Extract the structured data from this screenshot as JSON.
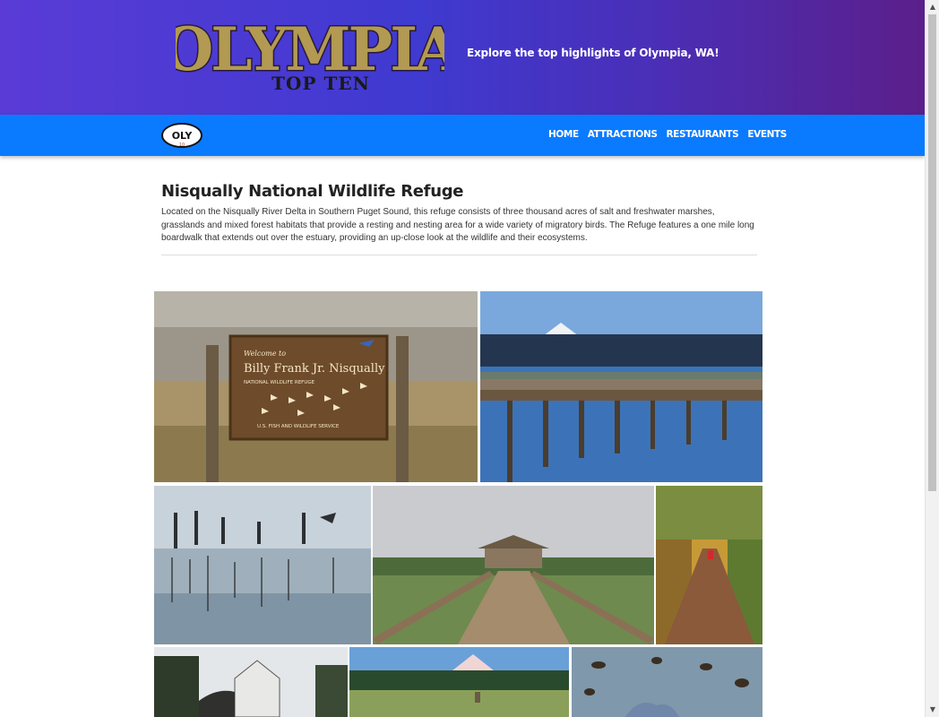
{
  "header": {
    "logo_text": "OLYMPIA",
    "logo_subtext": "TOP TEN",
    "tagline": "Explore the top highlights of Olympia, WA!"
  },
  "nav": {
    "logo_text": "OLY",
    "links": [
      "HOME",
      "ATTRACTIONS",
      "RESTAURANTS",
      "EVENTS"
    ]
  },
  "article": {
    "title": "Nisqually National Wildlife Refuge",
    "description": "Located on the Nisqually River Delta in Southern Puget Sound, this refuge consists of three thousand acres of salt and freshwater marshes, grasslands and mixed forest habitats that provide a resting and nesting area for a wide variety of migratory birds. The Refuge features a one mile long boardwalk that extends out over the estuary, providing an up-close look at the wildlife and their ecosystems."
  },
  "gallery": {
    "sign_photo": {
      "welcome": "Welcome to",
      "name": "Billy Frank Jr. Nisqually",
      "subtitle": "NATIONAL WILDLIFE REFUGE",
      "agency": "U.S. FISH AND WILDLIFE SERVICE"
    }
  },
  "colors": {
    "banner_start": "#5a3bd6",
    "banner_end": "#5b1f8a",
    "nav": "#0a7bff",
    "logo_gold": "#b29a52"
  }
}
